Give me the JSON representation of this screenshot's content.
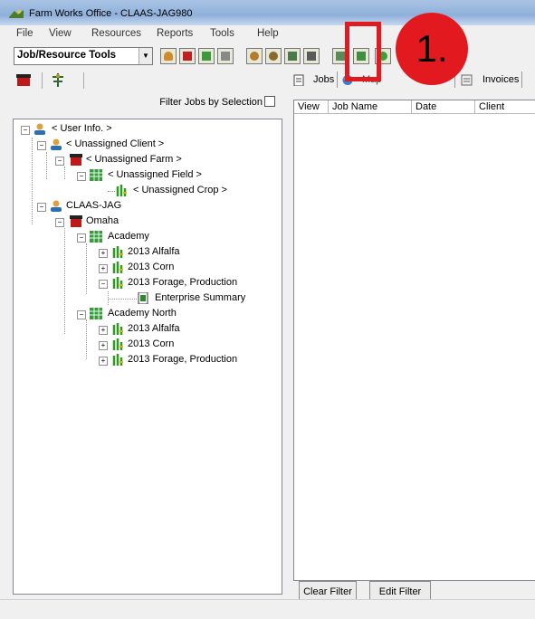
{
  "window": {
    "title": "Farm Works Office - CLAAS-JAG980"
  },
  "menu": [
    "File",
    "View",
    "Resources",
    "Reports",
    "Tools",
    "Help"
  ],
  "toolbar": {
    "combo_value": "Job/Resource Tools"
  },
  "left_panel": {
    "filter_label": "Filter Jobs by Selection"
  },
  "tree": [
    {
      "label": "< User Info. >",
      "icon": "person-icon"
    },
    {
      "label": "< Unassigned Client >",
      "icon": "person-icon"
    },
    {
      "label": "< Unassigned Farm >",
      "icon": "barn-icon"
    },
    {
      "label": "< Unassigned Field >",
      "icon": "field-icon"
    },
    {
      "label": "< Unassigned Crop >",
      "icon": "crop-icon"
    },
    {
      "label": "CLAAS-JAG",
      "icon": "person-icon"
    },
    {
      "label": "Omaha",
      "icon": "barn-icon"
    },
    {
      "label": "Academy",
      "icon": "field-icon"
    },
    {
      "label": "2013 Alfalfa",
      "icon": "crop-icon"
    },
    {
      "label": "2013 Corn",
      "icon": "crop-icon"
    },
    {
      "label": "2013 Forage, Production",
      "icon": "crop-icon"
    },
    {
      "label": "Enterprise Summary",
      "icon": "document-icon"
    },
    {
      "label": "Academy North",
      "icon": "field-icon"
    },
    {
      "label": "2013 Alfalfa",
      "icon": "crop-icon"
    },
    {
      "label": "2013 Corn",
      "icon": "crop-icon"
    },
    {
      "label": "2013 Forage, Production",
      "icon": "crop-icon"
    }
  ],
  "right_panel": {
    "tabs": [
      "Jobs",
      "Map",
      "Invoices"
    ],
    "columns": [
      "View",
      "Job Name",
      "Date",
      "Client"
    ],
    "clear_filter": "Clear Filter",
    "edit_filter": "Edit Filter"
  },
  "annotation": {
    "label": "1.",
    "color": "#e2191e"
  }
}
